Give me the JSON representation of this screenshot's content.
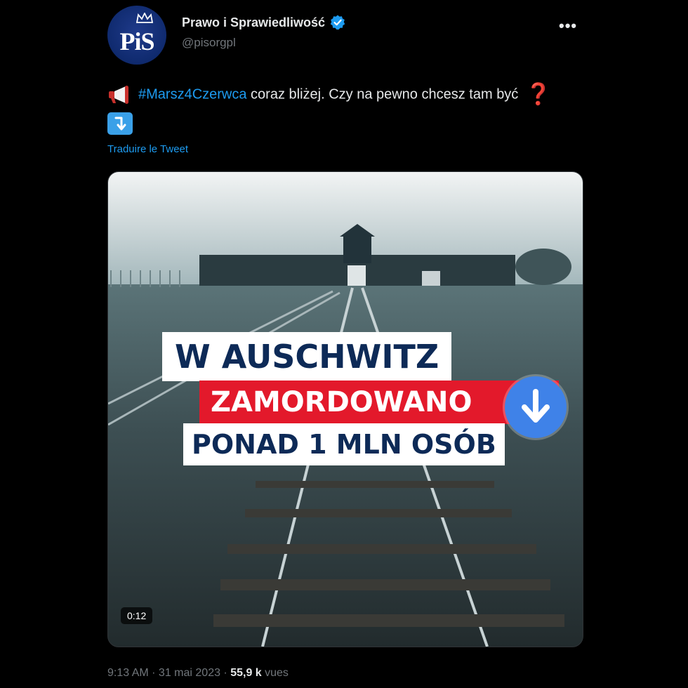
{
  "author": {
    "logo_text": "PiS",
    "name": "Prawo i Sprawiedliwość",
    "handle": "@pisorgpl",
    "verified_icon": "verified-badge-icon"
  },
  "more_icon": "•••",
  "tweet": {
    "icons": [
      "megaphone-icon",
      "red-question-mark-icon",
      "arrow-down-right-icon"
    ],
    "hashtag": "#Marsz4Czerwca",
    "text": " coraz bliżej. Czy na pewno chcesz tam być",
    "qmark": "❓",
    "translate_label": "Traduire le Tweet"
  },
  "media": {
    "line1": "W AUSCHWITZ",
    "line2": "ZAMORDOWANO",
    "line3": "PONAD 1 MLN OSÓB",
    "duration": "0:12",
    "download_icon": "download-arrow-icon",
    "colors": {
      "navy": "#0d2a57",
      "red": "#e3192b",
      "button": "#3f82e8"
    }
  },
  "meta": {
    "time_date": "9:13 AM · 31 mai 2023 · ",
    "views_count": "55,9 k",
    "views_label": " vues"
  }
}
